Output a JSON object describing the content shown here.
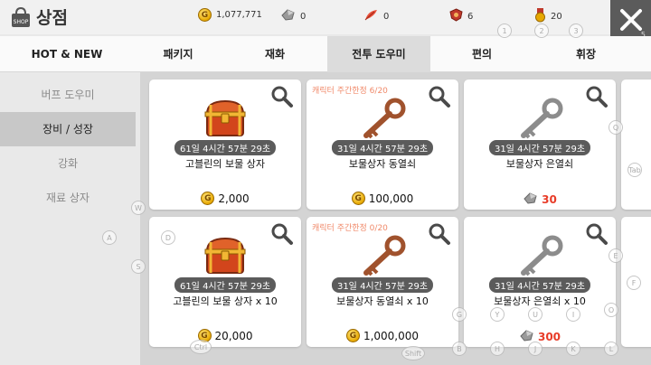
{
  "header": {
    "title": "상점",
    "currencies": [
      {
        "icon": "gold-coin-icon",
        "value": "1,077,771"
      },
      {
        "icon": "silver-gem-icon",
        "value": "0"
      },
      {
        "icon": "red-feather-icon",
        "value": "0"
      },
      {
        "icon": "emblem-badge-icon",
        "value": "6"
      },
      {
        "icon": "medal-icon",
        "value": "20"
      }
    ],
    "close_hint": "5"
  },
  "tabs": [
    {
      "label": "HOT & NEW"
    },
    {
      "label": "패키지"
    },
    {
      "label": "재화"
    },
    {
      "label": "전투 도우미",
      "active": true
    },
    {
      "label": "편의"
    },
    {
      "label": "휘장"
    }
  ],
  "sidebar": [
    {
      "label": "버프 도우미"
    },
    {
      "label": "장비 / 성장",
      "active": true
    },
    {
      "label": "강화"
    },
    {
      "label": "재료 상자"
    }
  ],
  "items": [
    {
      "limit": "",
      "timer": "61일 4시간 57분 29초",
      "name": "고블린의 보물 상자",
      "price": "2,000",
      "currency": "gold",
      "icon": "treasure-chest-icon"
    },
    {
      "limit": "캐릭터 주간한정 6/20",
      "timer": "31일 4시간 57분 29초",
      "name": "보물상자 동열쇠",
      "price": "100,000",
      "currency": "gold",
      "icon": "bronze-key-icon"
    },
    {
      "limit": "",
      "timer": "31일 4시간 57분 29초",
      "name": "보물상자 은열쇠",
      "price": "30",
      "currency": "gem",
      "icon": "silver-key-icon"
    },
    {
      "limit": "",
      "timer": "61일 4시간 57분 29초",
      "name": "고블린의 보물 상자 x 10",
      "price": "20,000",
      "currency": "gold",
      "icon": "treasure-chest-icon"
    },
    {
      "limit": "캐릭터 주간한정 0/20",
      "timer": "31일 4시간 57분 29초",
      "name": "보물상자 동열쇠 x 10",
      "price": "1,000,000",
      "currency": "gold",
      "icon": "bronze-key-icon"
    },
    {
      "limit": "",
      "timer": "31일 4시간 57분 29초",
      "name": "보물상자 은열쇠 x 10",
      "price": "300",
      "currency": "gem",
      "icon": "silver-key-icon"
    }
  ],
  "key_hints": {
    "one": "1",
    "two": "2",
    "three": "3",
    "w": "W",
    "a": "A",
    "s": "S",
    "d": "D",
    "e": "E",
    "f": "F",
    "g": "G",
    "y": "Y",
    "u": "U",
    "i": "I",
    "o": "O",
    "b": "B",
    "h": "H",
    "j": "J",
    "k": "K",
    "l": "L",
    "q": "Q",
    "tab": "Tab",
    "ctrl": "Ctrl",
    "shift": "Shift"
  }
}
